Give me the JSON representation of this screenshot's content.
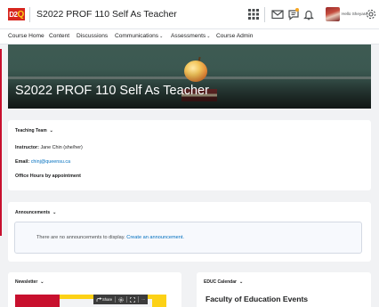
{
  "header": {
    "logo_text": "D2",
    "logo_accent": "Q",
    "course_title": "S2022 PROF 110 Self As Teacher",
    "user_name": "Hello Sheyard",
    "icons": [
      "apps-grid-icon",
      "mail-icon",
      "chat-icon",
      "bell-icon",
      "gear-icon"
    ],
    "alert_color": "#f5a623"
  },
  "nav": {
    "items": [
      {
        "label": "Course Home"
      },
      {
        "label": "Content"
      },
      {
        "label": "Discussions"
      },
      {
        "label": "Communications",
        "has_menu": true
      },
      {
        "label": "Assessments",
        "has_menu": true
      },
      {
        "label": "Course Admin"
      }
    ],
    "chevron": "⌄"
  },
  "banner": {
    "title": "S2022 PROF 110 Self As Teacher"
  },
  "teaching_team": {
    "heading": "Teaching Team",
    "instructor_label": "Instructor:",
    "instructor_value": "Jane Chin    (she/her)",
    "email_label": "Email:",
    "email_value": "chinj@queensu.ca",
    "office_hours": "Office Hours by appointment"
  },
  "announcements": {
    "heading": "Announcements",
    "empty_text": "There are no announcements to display.",
    "create_link": "Create an announcement."
  },
  "newsletter": {
    "heading": "Newsletter",
    "toolbar": {
      "share_label": "Share",
      "more_label": "···"
    }
  },
  "calendar": {
    "heading": "EDUC Calendar",
    "title": "Faculty of Education Events"
  },
  "colors": {
    "brand_red": "#c8102e",
    "brand_yellow": "#fcd116",
    "link_blue": "#006fbf"
  }
}
